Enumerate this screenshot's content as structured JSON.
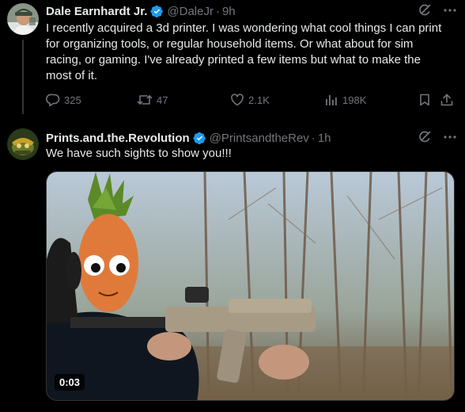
{
  "post1": {
    "name": "Dale Earnhardt Jr.",
    "handle": "@DaleJr",
    "separator": "·",
    "time": "9h",
    "lines": [
      "I recently acquired a 3d printer. I was wondering what cool things I can print",
      "for organizing tools, or regular household items. Or what about for sim",
      "racing, or gaming. I've already printed a few items but what to make the",
      "most of it."
    ],
    "actions": {
      "replies": "325",
      "reposts": "47",
      "likes": "2.1K",
      "views": "198K"
    }
  },
  "post2": {
    "name": "Prints.and.the.Revolution",
    "handle": "@PrintsandtheRev",
    "separator": "·",
    "time": "1h",
    "text": "We have such sights to show you!!!",
    "video_duration": "0:03"
  },
  "colors": {
    "background": "#000000",
    "text_primary": "#e7e9ea",
    "text_secondary": "#71767b",
    "verified_blue": "#1d9bf0"
  }
}
